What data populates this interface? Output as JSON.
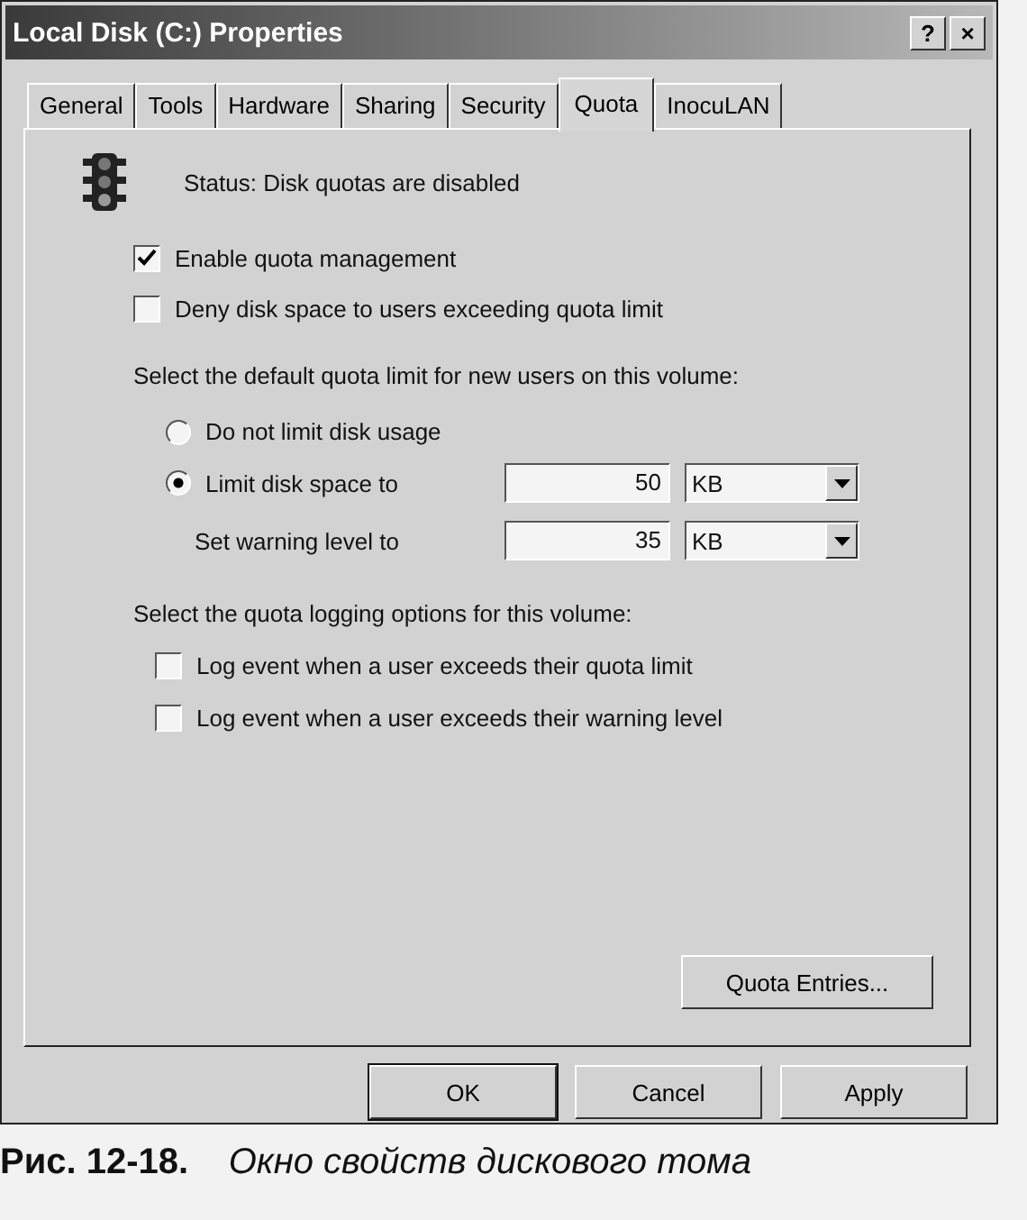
{
  "window": {
    "title": "Local Disk (C:) Properties",
    "title_buttons": [
      "?",
      "×"
    ]
  },
  "tabs": [
    {
      "label": "General",
      "selected": false
    },
    {
      "label": "Tools",
      "selected": false
    },
    {
      "label": "Hardware",
      "selected": false
    },
    {
      "label": "Sharing",
      "selected": false
    },
    {
      "label": "Security",
      "selected": false
    },
    {
      "label": "Quota",
      "selected": true
    },
    {
      "label": "InocuLAN",
      "selected": false
    }
  ],
  "status": "Status:  Disk quotas are disabled",
  "options": [
    {
      "label": "Enable quota management",
      "checked": true
    },
    {
      "label": "Deny disk space to users exceeding quota limit",
      "checked": false
    }
  ],
  "limit_heading": "Select the default quota limit for new users on this volume:",
  "limit_choices": [
    {
      "label": "Do not limit disk usage",
      "selected": false
    },
    {
      "label": "Limit disk space to",
      "selected": true
    }
  ],
  "limit_fields": [
    {
      "value": "50",
      "unit": "KB"
    },
    {
      "label": "Set warning level to",
      "value": "35",
      "unit": "KB"
    }
  ],
  "logging_heading": "Select the quota logging options for this volume:",
  "logging": [
    {
      "label": "Log event when a user exceeds their quota limit",
      "checked": false
    },
    {
      "label": "Log event when a user exceeds their warning level",
      "checked": false
    }
  ],
  "entries_button": "Quota Entries...",
  "buttons": [
    "OK",
    "Cancel",
    "Apply"
  ],
  "caption": {
    "number": "Рис. 12-18.",
    "text": "Окно свойств дискового тома"
  }
}
